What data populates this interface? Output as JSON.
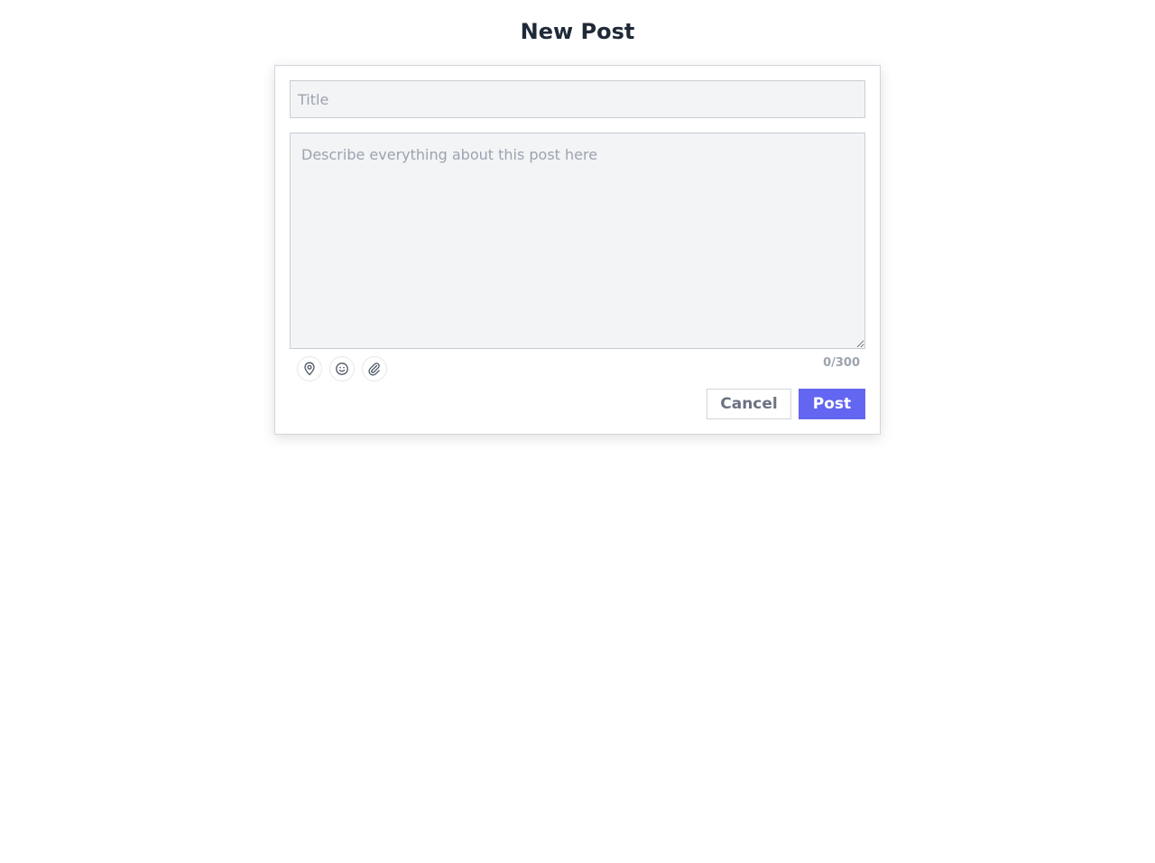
{
  "page": {
    "title": "New Post"
  },
  "form": {
    "title_placeholder": "Title",
    "title_value": "",
    "description_placeholder": "Describe everything about this post here",
    "description_value": "",
    "char_count": "0/300"
  },
  "toolbar": {
    "icons": [
      "location-icon",
      "emoji-icon",
      "attachment-icon"
    ]
  },
  "actions": {
    "cancel_label": "Cancel",
    "post_label": "Post"
  },
  "colors": {
    "accent": "#6366f1",
    "accent_text": "#ffffff",
    "heading": "#1f2937",
    "field_bg": "#f3f4f6",
    "placeholder": "#9ca3af"
  }
}
